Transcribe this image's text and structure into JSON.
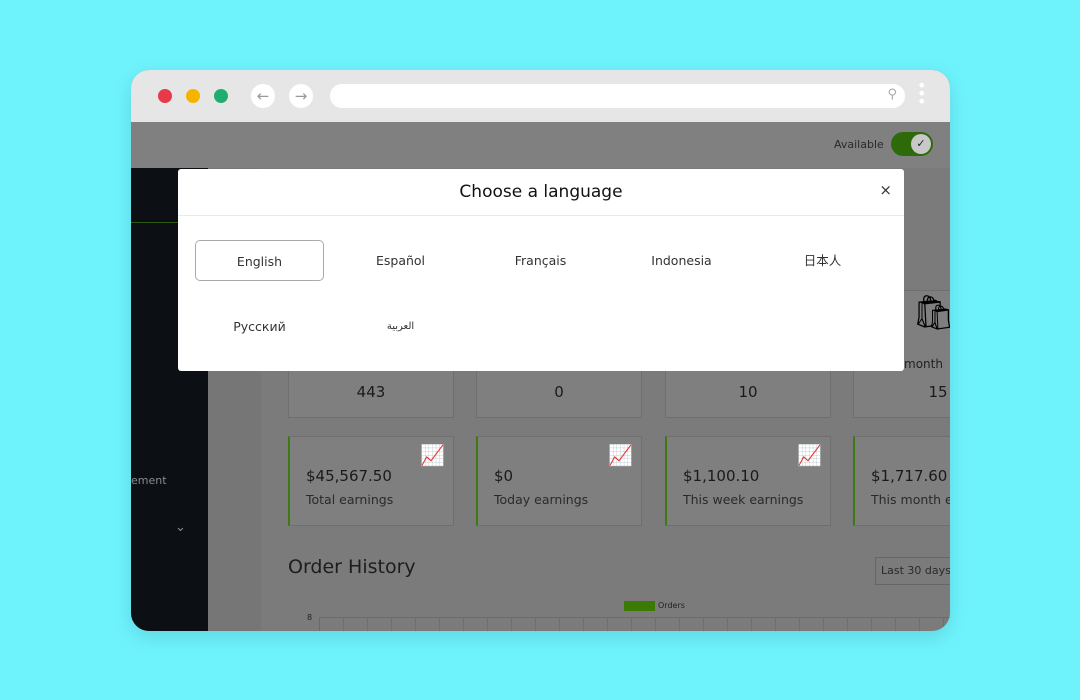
{
  "browser": {
    "dots": [
      "#e8394a",
      "#f4b400",
      "#1fae6f"
    ],
    "back_icon": "arrow-left",
    "forward_icon": "arrow-right",
    "search_icon": "magnifier",
    "menu_icon": "kebab"
  },
  "topbar": {
    "available_label": "Available",
    "available_on": true
  },
  "sidebar": {
    "partial_item": "ement"
  },
  "stats": [
    "443",
    "0",
    "10",
    "15"
  ],
  "stat_partial_label": "month",
  "earnings": [
    {
      "amount": "$45,567.50",
      "label": "Total earnings"
    },
    {
      "amount": "$0",
      "label": "Today earnings"
    },
    {
      "amount": "$1,100.10",
      "label": "This week earnings"
    },
    {
      "amount": "$1,717.60",
      "label": "This month earnings"
    }
  ],
  "order_history": {
    "title": "Order History",
    "range": "Last 30 days",
    "legend": "Orders",
    "y_top": "8",
    "accent": "#3a7a05"
  },
  "modal": {
    "title": "Choose a language",
    "close": "×",
    "languages": [
      "English",
      "Español",
      "Français",
      "Indonesia",
      "日本人",
      "Русский",
      "العربية"
    ],
    "selected": "English"
  }
}
